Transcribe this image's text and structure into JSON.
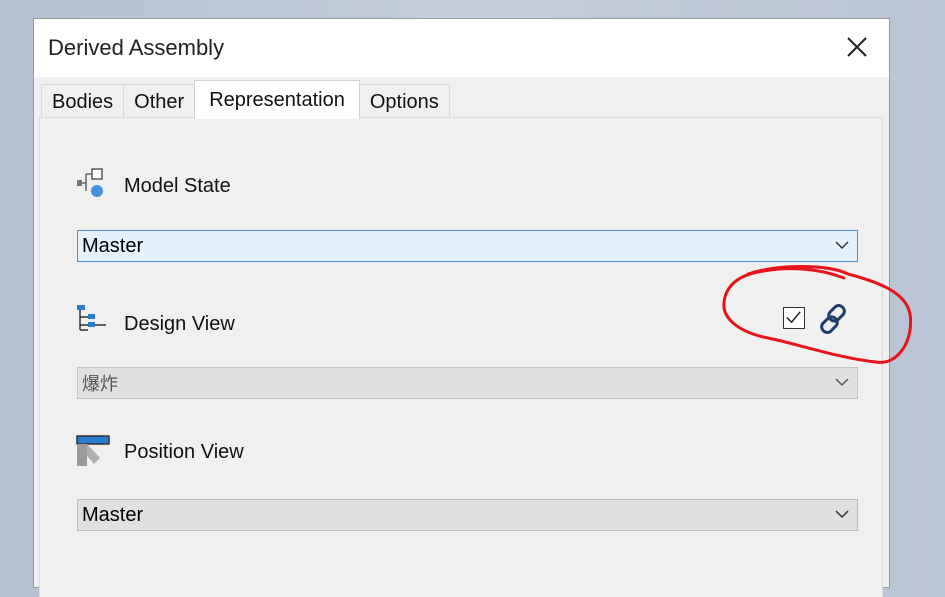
{
  "dialog": {
    "title": "Derived Assembly",
    "close_icon": "close-icon"
  },
  "tabs": [
    {
      "label": "Bodies",
      "active": false
    },
    {
      "label": "Other",
      "active": false
    },
    {
      "label": "Representation",
      "active": true
    },
    {
      "label": "Options",
      "active": false
    }
  ],
  "model_state": {
    "label": "Model State",
    "icon": "model-state-icon",
    "value": "Master"
  },
  "design_view": {
    "label": "Design View",
    "icon": "design-view-icon",
    "value": "爆炸",
    "associative_checked": true,
    "link_icon": "link-icon"
  },
  "position_view": {
    "label": "Position View",
    "icon": "position-view-icon",
    "value": "Master"
  },
  "annotation": {
    "color": "#e8141b"
  }
}
